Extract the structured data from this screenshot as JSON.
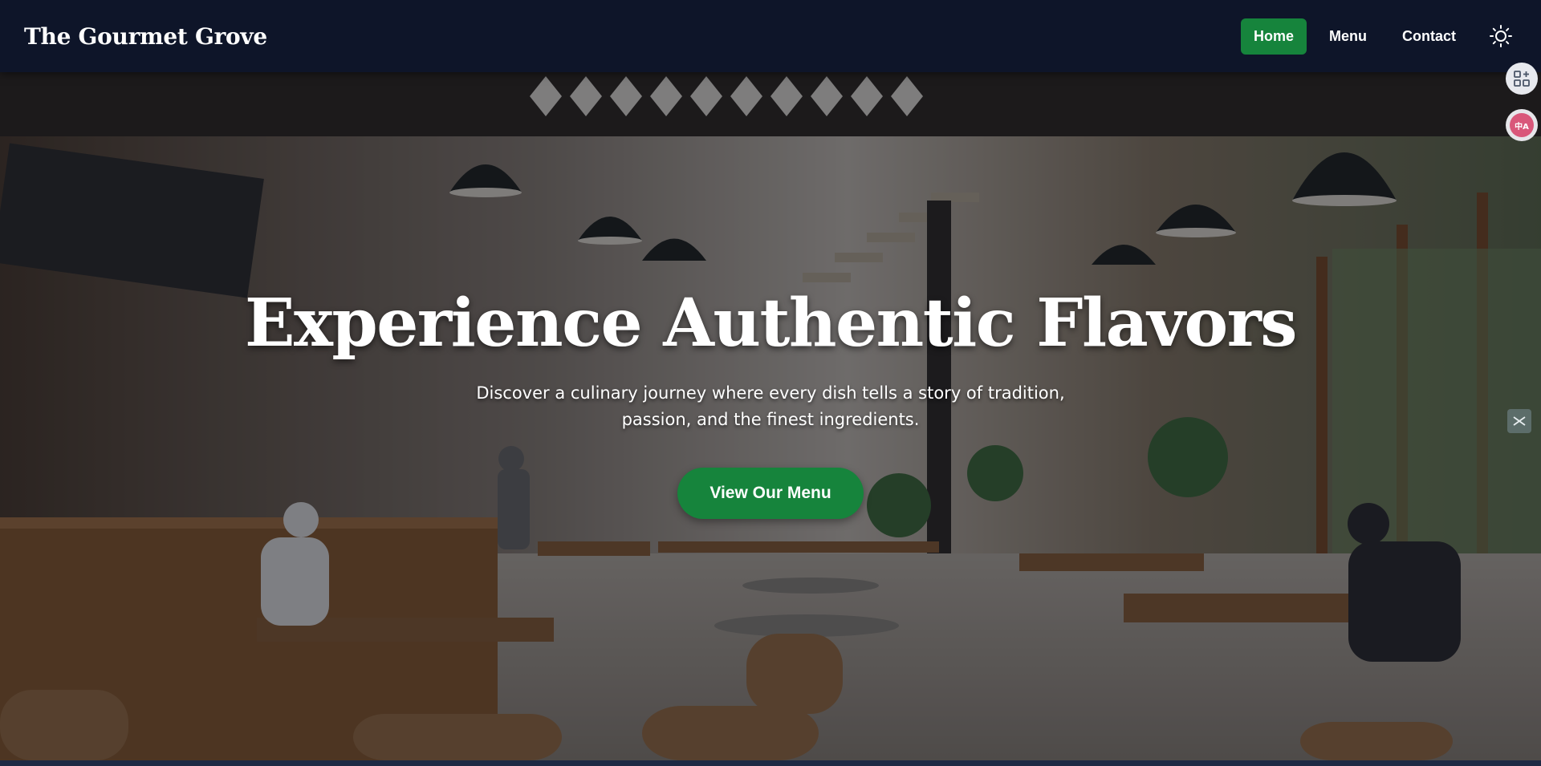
{
  "header": {
    "brand": "The Gourmet Grove",
    "nav": [
      {
        "label": "Home",
        "active": true
      },
      {
        "label": "Menu",
        "active": false
      },
      {
        "label": "Contact",
        "active": false
      }
    ],
    "theme_toggle_icon": "sun-icon"
  },
  "hero": {
    "title": "Experience Authentic Flavors",
    "subtitle": "Discover a culinary journey where every dish tells a story of tradition, passion, and the finest ingredients.",
    "cta_label": "View Our Menu",
    "background": "restaurant-interior-photo"
  },
  "side_widgets": {
    "apps_icon": "apps-grid-icon",
    "translate_icon": "translate-icon",
    "translate_text": "中A",
    "side_tab_icon": "panel-tab-icon"
  },
  "colors": {
    "header_bg": "#0e1529",
    "accent_green": "#16843c",
    "text": "#ffffff"
  }
}
